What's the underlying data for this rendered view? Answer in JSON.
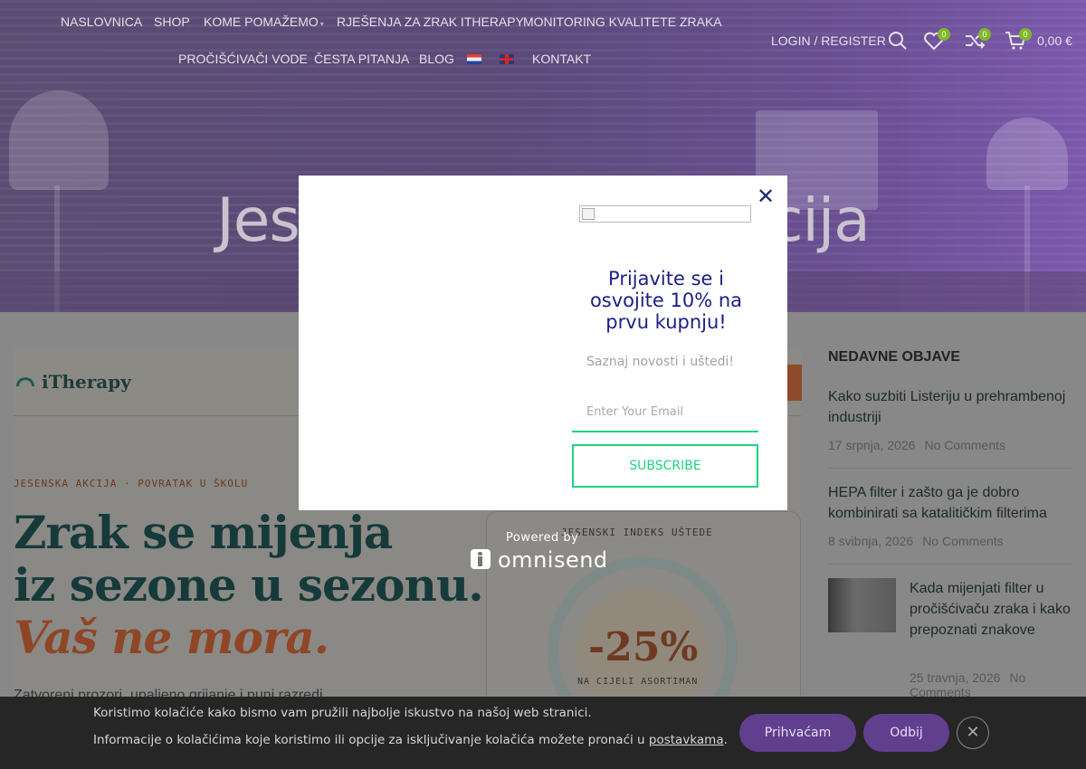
{
  "nav": {
    "row1": [
      "NASLOVNICA",
      "SHOP",
      "KOME POMAŽEMO",
      "RJEŠENJA ZA ZRAK ITHERAPY",
      "MONITORING KVALITETE ZRAKA"
    ],
    "row2": [
      "PROČIŠĆIVAČI VODE",
      "ČESTA PITANJA",
      "BLOG",
      "KONTAKT"
    ],
    "login": "LOGIN / REGISTER",
    "wishlist_count": "0",
    "compare_count": "0",
    "cart_count": "0",
    "cart_total": "0,00 €"
  },
  "hero": {
    "title_left": "Jesens",
    "title_right": "akcija"
  },
  "banner": {
    "logo": "iTherapy",
    "kicker": "JESENSKA AKCIJA · POVRATAK U ŠKOLU",
    "headline_line1": "Zrak se mijenja",
    "headline_line2": "iz sezone u sezonu.",
    "headline_line3": "Vaš ne mora.",
    "subtext": "Zatvoreni prozori, upaljeno grijanje i puni razredi",
    "index_title": "JESENSKI INDEKS UŠTEDE",
    "index_value": "-25%",
    "index_sub": "NA CIJELI ASORTIMAN"
  },
  "sidebar": {
    "heading": "NEDAVNE OBJAVE",
    "posts": [
      {
        "title": "Kako suzbiti Listeriju u prehrambenoj industriji",
        "date": "17 srpnja, 2026",
        "comments": "No Comments"
      },
      {
        "title": "HEPA filter i zašto ga je dobro kombinirati sa katalitičkim filterima",
        "date": "8 svibnja, 2026",
        "comments": "No Comments"
      },
      {
        "title": "Kada mijenjati filter u pročišćivaču zraka i kako prepoznati znakove",
        "date": "25 travnja, 2026",
        "comments": "No Comments"
      }
    ]
  },
  "popup": {
    "title": "Prijavite se i osvojite 10% na prvu kupnju!",
    "subtitle": "Saznaj novosti i uštedi!",
    "email_placeholder": "Enter Your Email",
    "subscribe_label": "SUBSCRIBE",
    "close_symbol": "✕",
    "powered_by": "Powered by",
    "brand": "omnisend"
  },
  "cookie": {
    "line1": "Koristimo kolačiće kako bismo vam pružili najbolje iskustvo na našoj web stranici.",
    "line2_prefix": "Informacije o kolačićima koje koristimo ili opcije za isključivanje kolačića možete pronaći u ",
    "line2_link": "postavkama",
    "line2_suffix": ".",
    "accept_label": "Prihvaćam",
    "reject_label": "Odbij",
    "close_symbol": "✕"
  },
  "colors": {
    "popup_title": "#1b1f86",
    "subscribe_green": "#1ed381",
    "cookie_button": "#613f8f",
    "badge_green": "#7fb82b"
  }
}
